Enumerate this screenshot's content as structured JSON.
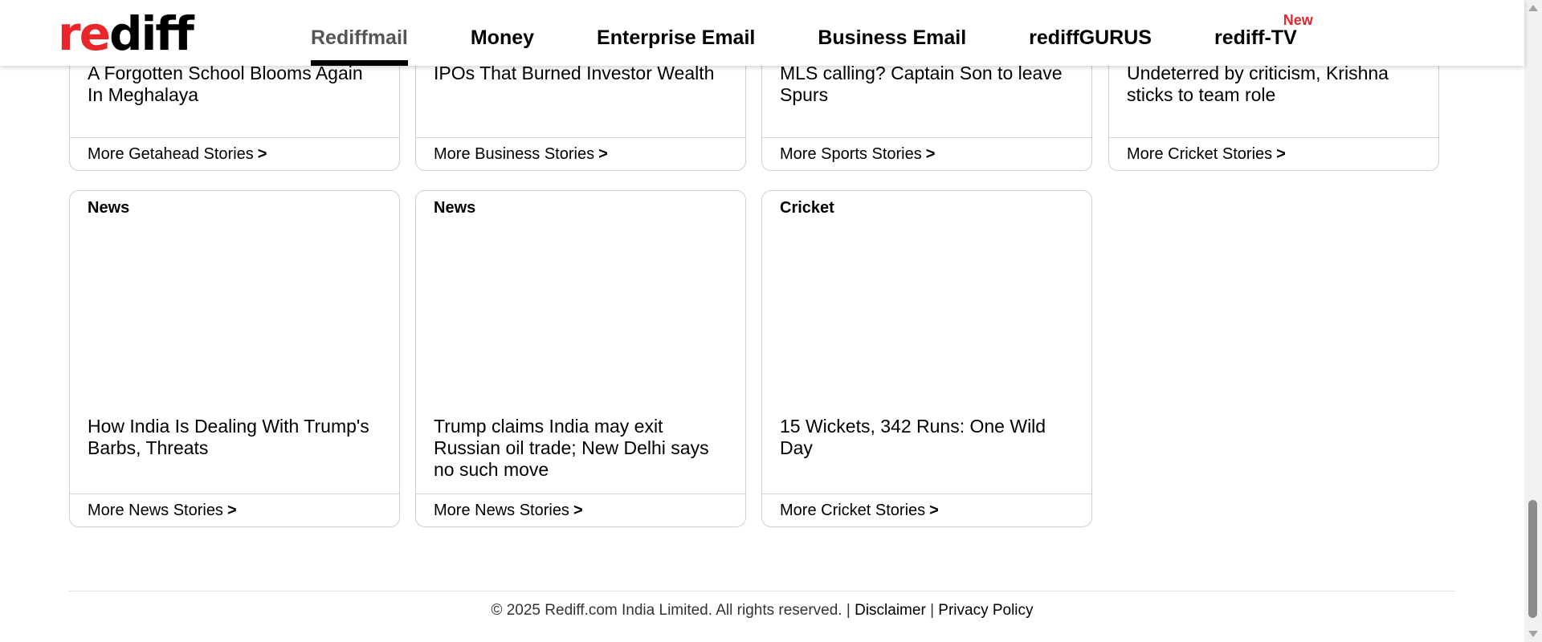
{
  "header": {
    "logo_red": "re",
    "logo_dark": "diff",
    "nav": [
      {
        "label": "Rediffmail"
      },
      {
        "label": "Money"
      },
      {
        "label": "Enterprise Email"
      },
      {
        "label": "Business Email"
      },
      {
        "label": "rediffGURUS"
      },
      {
        "label": "rediff-TV",
        "badge": "New"
      }
    ]
  },
  "cards_top": [
    {
      "title": "A Forgotten School Blooms Again In Meghalaya",
      "more": "More Getahead Stories"
    },
    {
      "title": "IPOs That Burned Investor Wealth",
      "more": "More Business Stories"
    },
    {
      "title": "MLS calling? Captain Son to leave Spurs",
      "more": "More Sports Stories"
    },
    {
      "title": "Undeterred by criticism, Krishna sticks to team role",
      "more": "More Cricket Stories"
    }
  ],
  "cards_bottom": [
    {
      "tag": "News",
      "title": "How India Is Dealing With Trump's Barbs, Threats",
      "more": "More News Stories"
    },
    {
      "tag": "News",
      "title": "Trump claims India may exit Russian oil trade; New Delhi says no such move",
      "more": "More News Stories"
    },
    {
      "tag": "Cricket",
      "title": "15 Wickets, 342 Runs: One Wild Day",
      "more": "More Cricket Stories"
    }
  ],
  "more_chevron": ">",
  "footer": {
    "copyright": "© 2025 Rediff.com India Limited. All rights reserved. |",
    "disclaimer": "Disclaimer",
    "separator": "|",
    "privacy": "Privacy Policy"
  }
}
